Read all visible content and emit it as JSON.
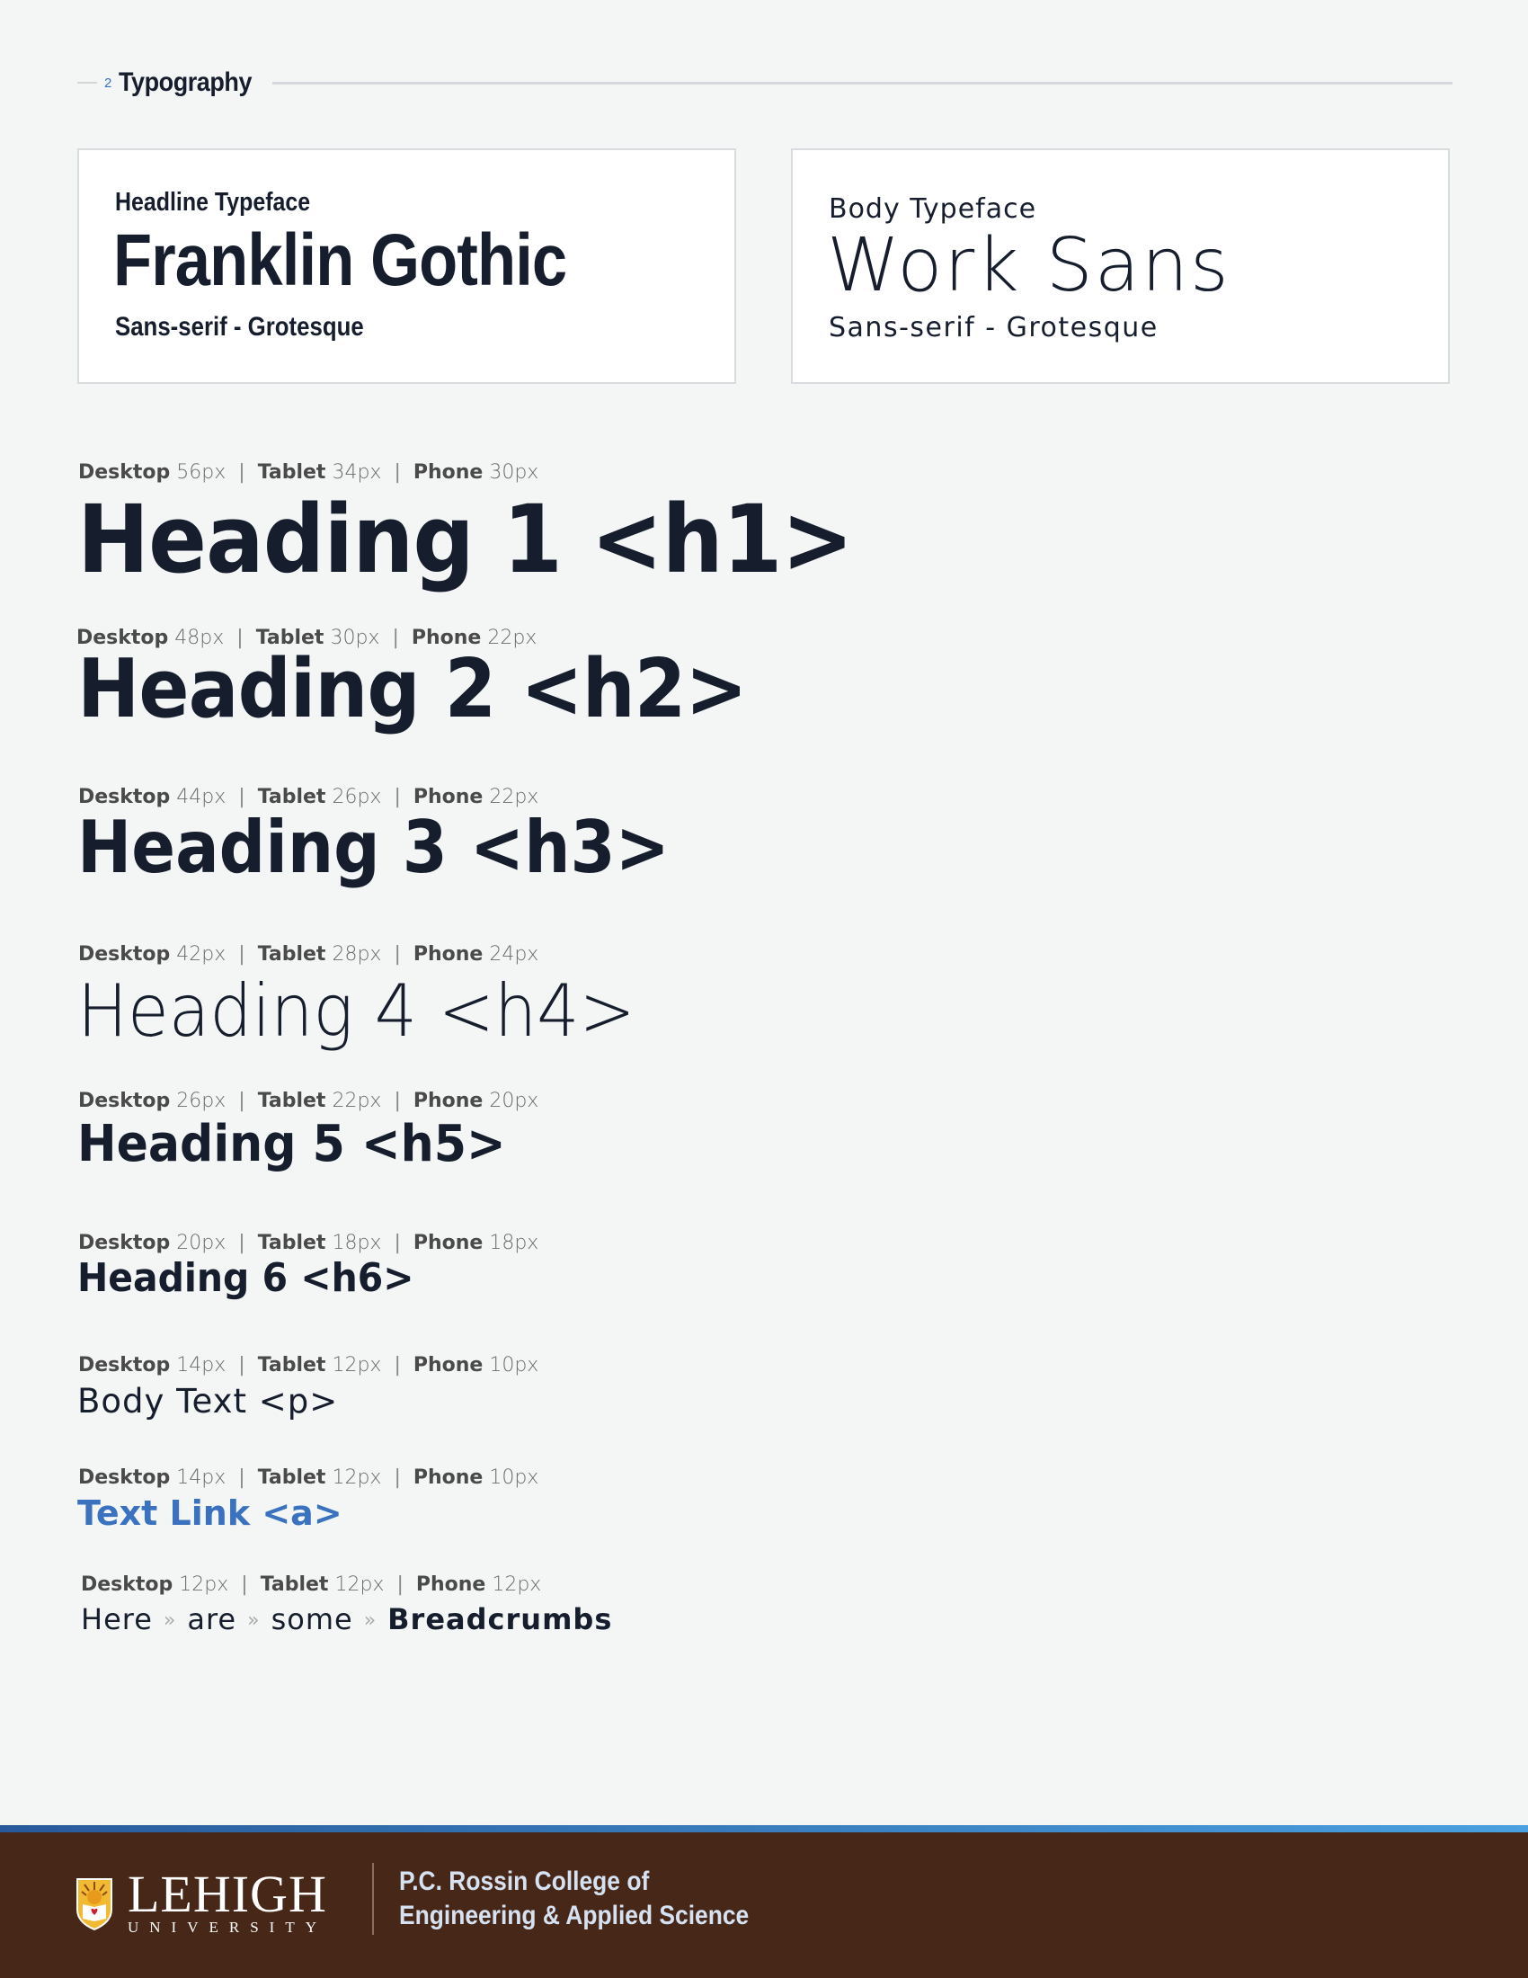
{
  "section": {
    "number": "2",
    "title": "Typography"
  },
  "typefaces": {
    "headline": {
      "label": "Headline Typeface",
      "name": "Franklin Gothic",
      "classification": "Sans-serif - Grotesque"
    },
    "body": {
      "label": "Body Typeface",
      "name": "Work Sans",
      "classification": "Sans-serif - Grotesque"
    }
  },
  "size_labels": {
    "desktop": "Desktop",
    "tablet": "Tablet",
    "phone": "Phone",
    "separator": "|"
  },
  "styles": [
    {
      "id": "h1",
      "sample": "Heading 1 <h1>",
      "desktop": "56px",
      "tablet": "34px",
      "phone": "30px"
    },
    {
      "id": "h2",
      "sample": "Heading 2 <h2>",
      "desktop": "48px",
      "tablet": "30px",
      "phone": "22px"
    },
    {
      "id": "h3",
      "sample": "Heading 3 <h3>",
      "desktop": "44px",
      "tablet": "26px",
      "phone": "22px"
    },
    {
      "id": "h4",
      "sample": "Heading 4 <h4>",
      "desktop": "42px",
      "tablet": "28px",
      "phone": "24px"
    },
    {
      "id": "h5",
      "sample": "Heading 5 <h5>",
      "desktop": "26px",
      "tablet": "22px",
      "phone": "20px"
    },
    {
      "id": "h6",
      "sample": "Heading 6 <h6>",
      "desktop": "20px",
      "tablet": "18px",
      "phone": "18px"
    },
    {
      "id": "p",
      "sample": "Body Text <p>",
      "desktop": "14px",
      "tablet": "12px",
      "phone": "10px"
    },
    {
      "id": "a",
      "sample": "Text Link <a>",
      "desktop": "14px",
      "tablet": "12px",
      "phone": "10px"
    },
    {
      "id": "breadcrumbs",
      "desktop": "12px",
      "tablet": "12px",
      "phone": "12px"
    }
  ],
  "breadcrumbs": {
    "items": [
      "Here",
      "are",
      "some"
    ],
    "current": "Breadcrumbs",
    "separator": "»"
  },
  "colors": {
    "text": "#161e2e",
    "link": "#3a72c0",
    "footer_bg": "#472718",
    "stripe_start": "#285a9b",
    "stripe_end": "#4aa0e0"
  },
  "footer": {
    "logo_name": "LEHIGH",
    "logo_sub": "UNIVERSITY",
    "college_line1": "P.C. Rossin College of",
    "college_line2": "Engineering & Applied Science"
  }
}
